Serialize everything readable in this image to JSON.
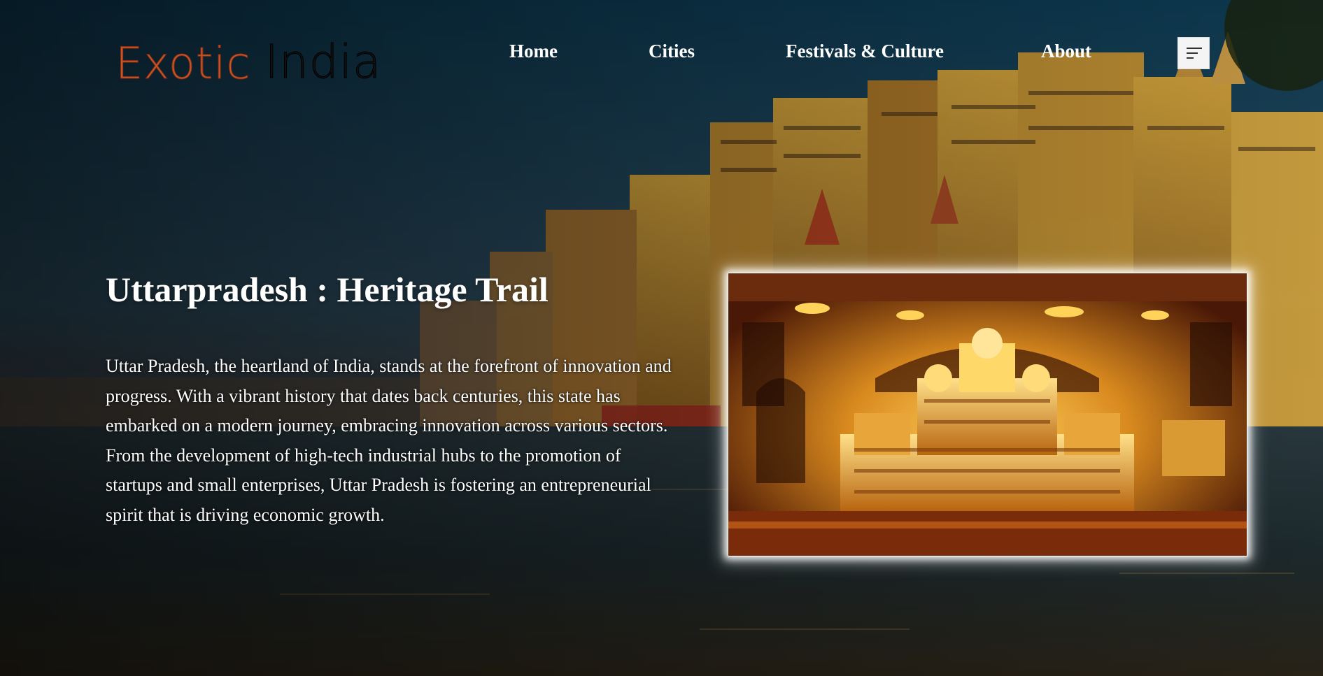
{
  "brand": {
    "logo_word1": "Exotic",
    "logo_word2": "India",
    "logo_colors": {
      "word1": "#c9572a",
      "word2": "#111111"
    }
  },
  "nav": {
    "items": [
      {
        "label": "Home"
      },
      {
        "label": "Cities"
      },
      {
        "label": "Festivals & Culture"
      },
      {
        "label": "About"
      }
    ],
    "menu_icon": "hamburger-menu-icon"
  },
  "hero": {
    "title": "Uttarpradesh : Heritage Trail",
    "description": "Uttar Pradesh, the heartland of India, stands at the forefront of innovation and progress. With a vibrant history that dates back centuries, this state has embarked on a modern journey, embracing innovation across various sectors. From the development of high-tech industrial hubs to the promotion of startups and small enterprises, Uttar Pradesh is fostering an entrepreneurial spirit that is driving economic growth."
  },
  "colors": {
    "sky_top": "#0e3347",
    "water": "#1a2a30",
    "buildings": "#c9952f",
    "feature_gold": "#e0a02a"
  }
}
